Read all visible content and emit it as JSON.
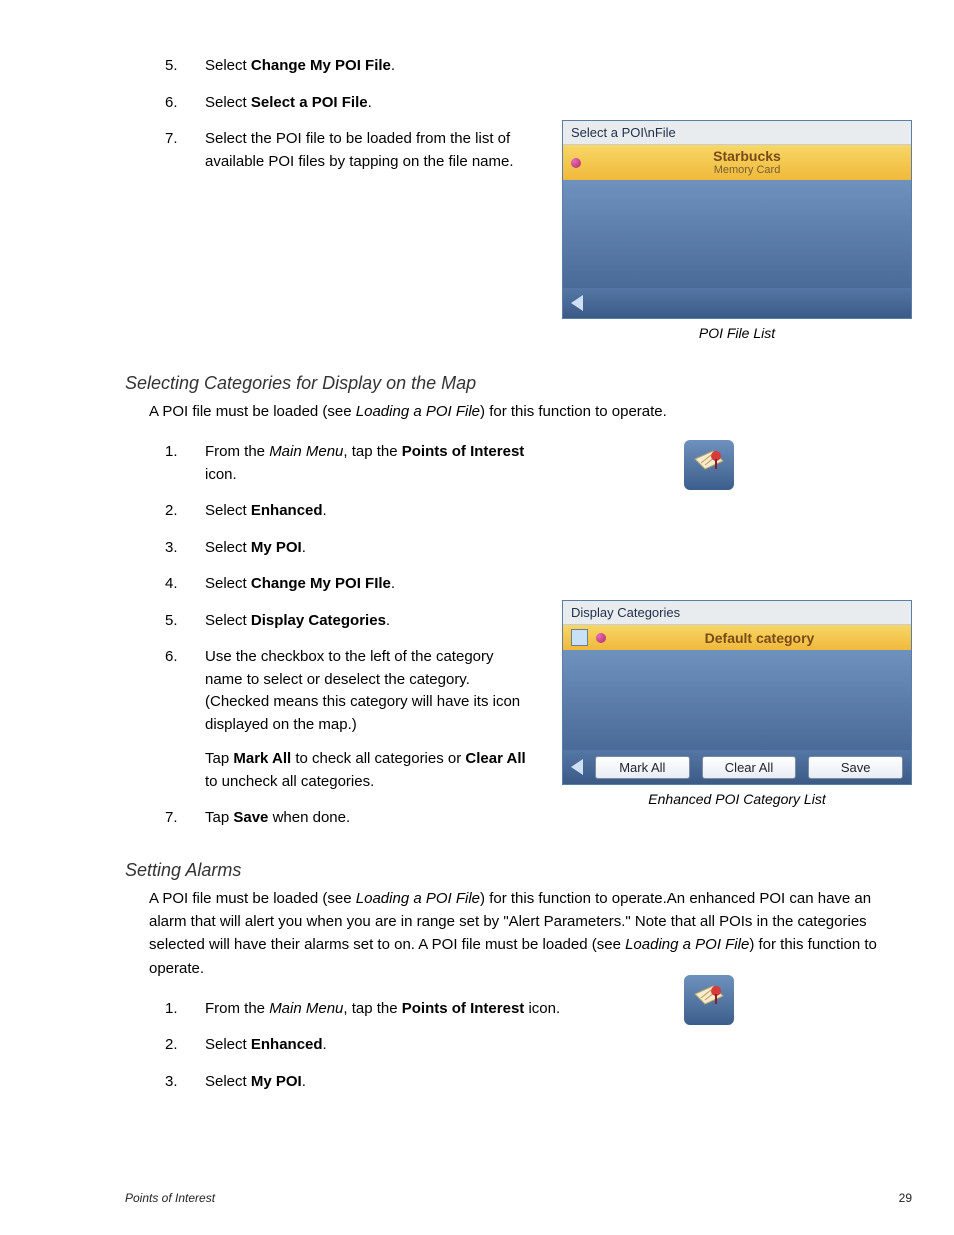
{
  "topSteps": [
    {
      "num": "5.",
      "pre": "Select ",
      "bold": "Change My POI File",
      "post": "."
    },
    {
      "num": "6.",
      "pre": "Select ",
      "bold": "Select a POI File",
      "post": "."
    },
    {
      "num": "7.",
      "text": "Select the POI file to be loaded from the list of available POI files by tapping on the file name."
    }
  ],
  "poiFileList": {
    "title": "Select a POI\\nFile",
    "item_name": "Starbucks",
    "item_sub": "Memory Card",
    "caption": "POI File List"
  },
  "sectionCategories": {
    "heading": "Selecting Categories for Display on the Map",
    "intro_pre": "A POI file must be loaded (see ",
    "intro_italic": "Loading a POI File",
    "intro_post": ") for this function to operate.",
    "steps": [
      {
        "num": "1.",
        "pre": "From the ",
        "italic": "Main Menu",
        "mid": ", tap the ",
        "bold": "Points of Interest",
        "post": " icon."
      },
      {
        "num": "2.",
        "pre": "Select ",
        "bold": "Enhanced",
        "post": "."
      },
      {
        "num": "3.",
        "pre": "Select ",
        "bold": "My POI",
        "post": "."
      },
      {
        "num": "4.",
        "pre": "Select ",
        "bold": "Change My POI FIle",
        "post": "."
      },
      {
        "num": "5.",
        "pre": "Select ",
        "bold": "Display Categories",
        "post": "."
      },
      {
        "num": "6.",
        "text": "Use the checkbox to the left of the category name to select or deselect the category. (Checked means this category will have its icon displayed on the map.)",
        "extra_pre": "Tap ",
        "extra_b1": "Mark All",
        "extra_mid": " to check all categories or ",
        "extra_b2": "Clear All",
        "extra_post": " to uncheck all categories."
      },
      {
        "num": "7.",
        "pre": "Tap ",
        "bold": "Save",
        "post": " when done."
      }
    ]
  },
  "displayCategories": {
    "title": "Display Categories",
    "item_name": "Default category",
    "btn_mark": "Mark All",
    "btn_clear": "Clear All",
    "btn_save": "Save",
    "caption": "Enhanced POI Category List"
  },
  "sectionAlarms": {
    "heading": "Setting Alarms",
    "intro_pre": "A POI file must be loaded (see ",
    "intro_italic1": "Loading a POI File",
    "intro_mid": ") for this function to operate.An enhanced POI can have an alarm that will alert you when you are in range set by \"Alert Parameters.\"  Note that all POIs in the categories selected will have their alarms set to on.  A POI file must be loaded (see ",
    "intro_italic2": "Loading a POI File",
    "intro_post": ") for this function to operate.",
    "steps": [
      {
        "num": "1.",
        "pre": "From the ",
        "italic": "Main Menu",
        "mid": ", tap the ",
        "bold": "Points of Interest",
        "post": " icon."
      },
      {
        "num": "2.",
        "pre": "Select ",
        "bold": "Enhanced",
        "post": "."
      },
      {
        "num": "3.",
        "pre": "Select ",
        "bold": "My POI",
        "post": "."
      }
    ]
  },
  "footer": {
    "section": "Points of Interest",
    "page": "29"
  }
}
